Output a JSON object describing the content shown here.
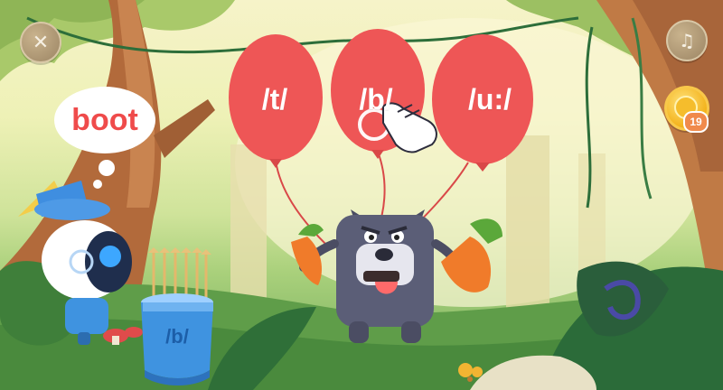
{
  "hud": {
    "close_icon": "close-icon",
    "music_icon": "music-note-icon",
    "close_glyph": "✕",
    "music_glyph": "♫",
    "coin_count": "19"
  },
  "balloons": [
    {
      "label": "/t/",
      "color": "#ee5656"
    },
    {
      "label": "/b/",
      "color": "#ee5656"
    },
    {
      "label": "/u:/",
      "color": "#ee5656"
    }
  ],
  "word_bubble": {
    "word": "boot"
  },
  "quiver": {
    "label": "/b/"
  },
  "colors": {
    "balloon_red": "#ee5656",
    "word_red": "#ef4b4b",
    "quiver_blue": "#3f93e0",
    "coin_gold": "#f5bd2c"
  }
}
